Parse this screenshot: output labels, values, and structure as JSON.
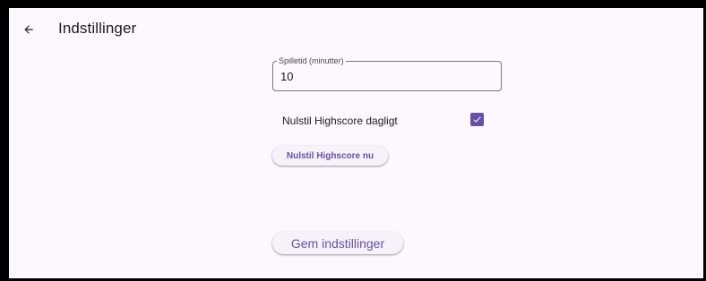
{
  "app_bar": {
    "title": "Indstillinger",
    "back_icon": "arrow-left-icon"
  },
  "settings": {
    "game_time": {
      "label": "Spilletid (minutter)",
      "value": "10"
    },
    "reset_daily": {
      "label": "Nulstil Highscore dagligt",
      "checked": true,
      "checkbox_icon": "checkmark-icon"
    },
    "reset_now_label": "Nulstil Highscore nu",
    "save_label": "Gem indstillinger"
  },
  "colors": {
    "background": "#fdf7ff",
    "primary": "#6750a4",
    "text": "#1d1b20",
    "outline": "#79747e",
    "button_surface": "#f7f2fa"
  }
}
